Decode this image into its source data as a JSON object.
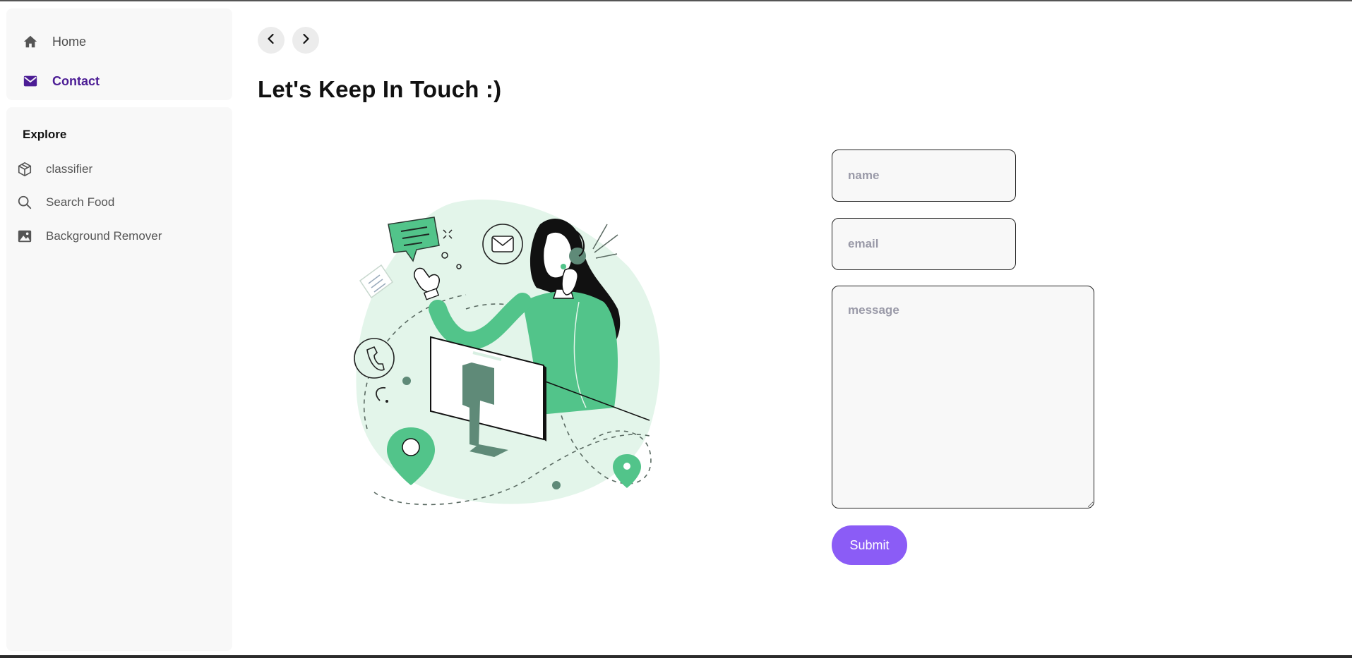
{
  "nav": {
    "items": [
      {
        "label": "Home",
        "icon": "home-icon",
        "active": false
      },
      {
        "label": "Contact",
        "icon": "mail-icon",
        "active": true
      }
    ]
  },
  "explore": {
    "title": "Explore",
    "items": [
      {
        "label": "classifier",
        "icon": "cube-icon"
      },
      {
        "label": "Search Food",
        "icon": "search-icon"
      },
      {
        "label": "Background Remover",
        "icon": "image-icon"
      }
    ]
  },
  "page": {
    "title": "Let's Keep In Touch :)"
  },
  "form": {
    "name_placeholder": "name",
    "email_placeholder": "email",
    "message_placeholder": "message",
    "submit_label": "Submit"
  },
  "colors": {
    "accent": "#8b5cf6",
    "active_nav": "#4c1d95",
    "illustration_green": "#52c48a",
    "sidebar_bg": "#f8f8f8"
  }
}
